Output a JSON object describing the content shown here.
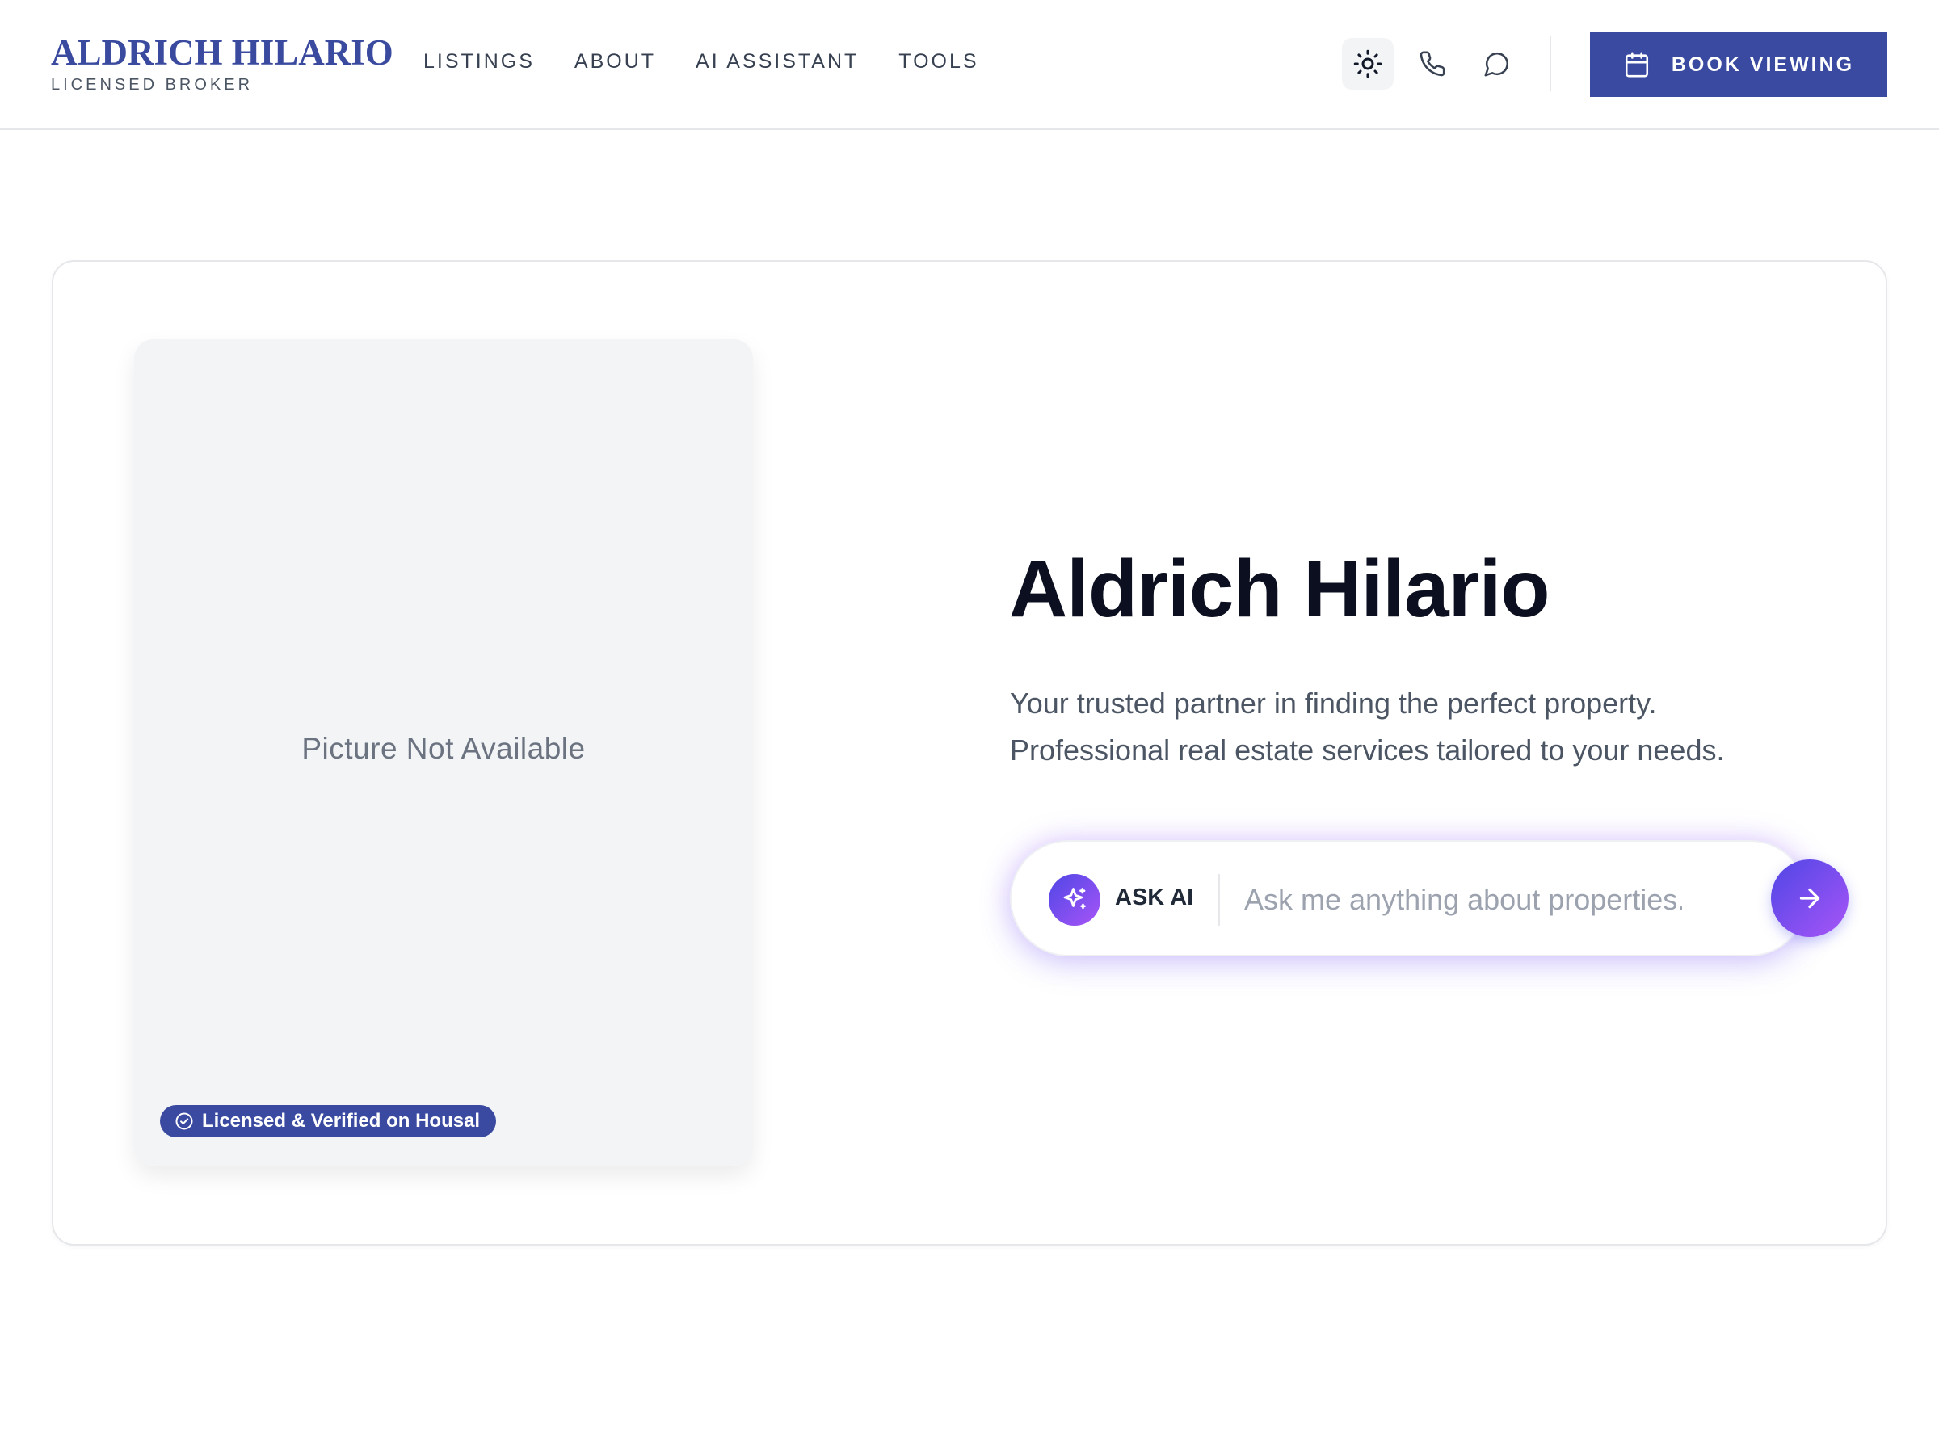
{
  "header": {
    "brand_name": "ALDRICH HILARIO",
    "brand_subtitle": "LICENSED BROKER",
    "nav": [
      {
        "label": "LISTINGS"
      },
      {
        "label": "ABOUT"
      },
      {
        "label": "AI ASSISTANT"
      },
      {
        "label": "TOOLS"
      }
    ],
    "icons": {
      "theme": "sun-icon",
      "phone": "phone-icon",
      "chat": "chat-bubble-icon"
    },
    "book_label": "BOOK VIEWING",
    "book_icon": "calendar-icon"
  },
  "hero": {
    "photo_placeholder": "Picture Not Available",
    "verified_badge": "Licensed & Verified on Housal",
    "title": "Aldrich Hilario",
    "description_line1": "Your trusted partner in finding the perfect property.",
    "description_line2": "Professional real estate services tailored to your needs."
  },
  "ask_ai": {
    "label": "ASK AI",
    "placeholder": "Ask me anything about properties...",
    "value": ""
  },
  "colors": {
    "brand": "#3a4a9f",
    "primary_button": "#3a4aa0",
    "ai_gradient_start": "#4f46e5",
    "ai_gradient_end": "#a855f7",
    "text_dark": "#0b0f1f",
    "text_muted": "#4b5563"
  }
}
